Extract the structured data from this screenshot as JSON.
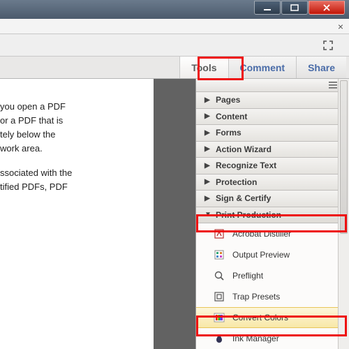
{
  "tabs": {
    "tools": "Tools",
    "comment": "Comment",
    "share": "Share"
  },
  "doc": {
    "p1_l1": "you open a PDF",
    "p1_l2": "or a PDF that is",
    "p1_l3": "tely below the",
    "p1_l4": "work area.",
    "p2_l1": "ssociated with the",
    "p2_l2": "tified PDFs, PDF"
  },
  "sections": {
    "pages": "Pages",
    "content": "Content",
    "forms": "Forms",
    "action_wizard": "Action Wizard",
    "recognize_text": "Recognize Text",
    "protection": "Protection",
    "sign_certify": "Sign & Certify",
    "print_production": "Print Production"
  },
  "print_production_items": {
    "acrobat_distiller": "Acrobat Distiller",
    "output_preview": "Output Preview",
    "preflight": "Preflight",
    "trap_presets": "Trap Presets",
    "convert_colors": "Convert Colors",
    "ink_manager": "Ink Manager"
  }
}
